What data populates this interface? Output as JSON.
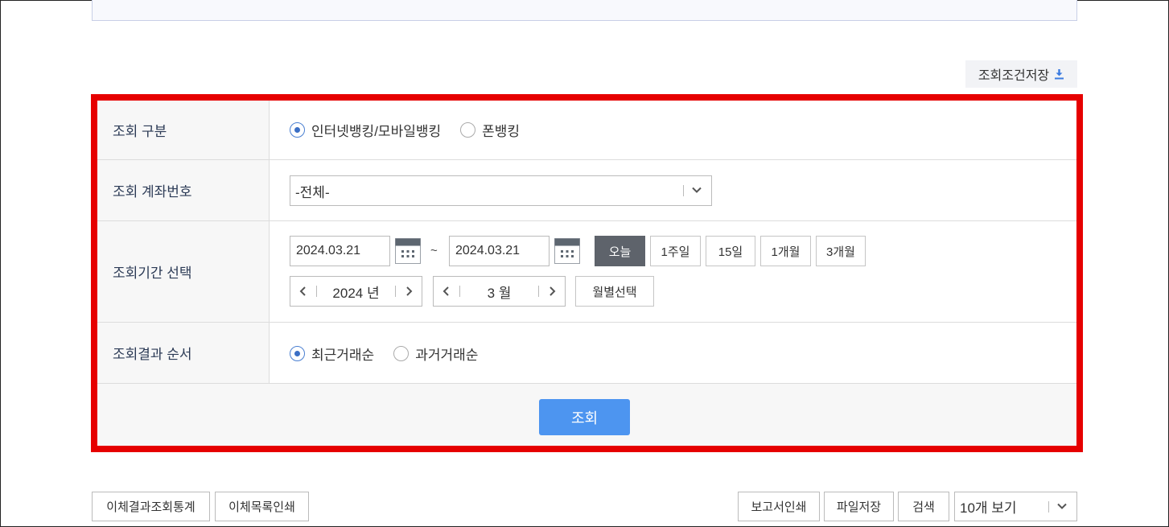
{
  "toolbar": {
    "save_conditions_label": "조회조건저장"
  },
  "form": {
    "inquiry_type": {
      "label": "조회 구분",
      "options": [
        {
          "label": "인터넷뱅킹/모바일뱅킹",
          "selected": true
        },
        {
          "label": "폰뱅킹",
          "selected": false
        }
      ]
    },
    "account": {
      "label": "조회 계좌번호",
      "selected_value": "-전체-"
    },
    "period": {
      "label": "조회기간 선택",
      "start_date": "2024.03.21",
      "end_date": "2024.03.21",
      "separator": "~",
      "quick_buttons": [
        "오늘",
        "1주일",
        "15일",
        "1개월",
        "3개월"
      ],
      "active_quick": "오늘",
      "year_value": "2024 년",
      "month_value": "3 월",
      "month_select_label": "월별선택"
    },
    "order": {
      "label": "조회결과 순서",
      "options": [
        {
          "label": "최근거래순",
          "selected": true
        },
        {
          "label": "과거거래순",
          "selected": false
        }
      ]
    },
    "search_label": "조회"
  },
  "bottom": {
    "left_buttons": [
      "이체결과조회통계",
      "이체목록인쇄"
    ],
    "right_buttons": [
      "보고서인쇄",
      "파일저장",
      "검색"
    ],
    "page_size_value": "10개 보기"
  },
  "colors": {
    "highlight_border": "#e60000",
    "primary_button": "#4d95f0",
    "active_quick": "#5e636b"
  }
}
